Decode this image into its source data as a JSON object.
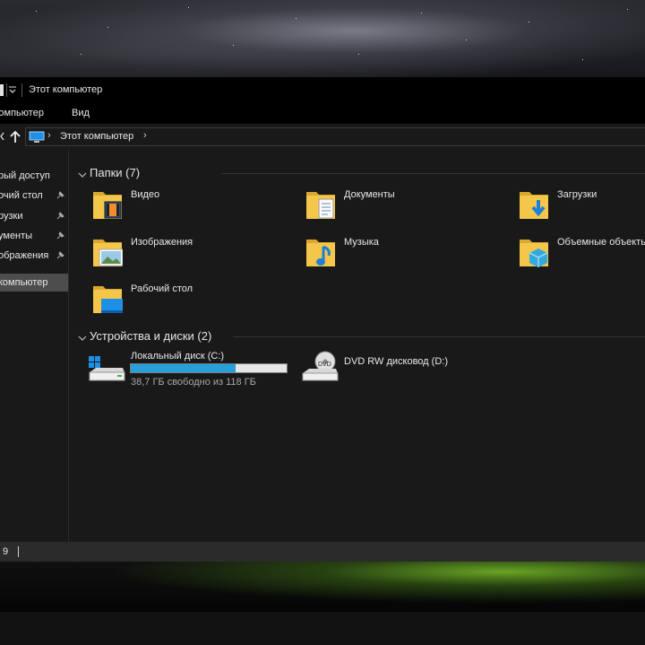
{
  "window": {
    "title": "Этот компьютер",
    "ribbon_tabs": [
      "Компьютер",
      "Вид"
    ],
    "address": {
      "path": "Этот компьютер"
    },
    "status": "9"
  },
  "nav": {
    "items": [
      {
        "label": "рый доступ",
        "pinned": false,
        "selected": false
      },
      {
        "label": "очий стол",
        "pinned": true,
        "selected": false
      },
      {
        "label": "рузки",
        "pinned": true,
        "selected": false
      },
      {
        "label": "ументы",
        "pinned": true,
        "selected": false
      },
      {
        "label": "ображения",
        "pinned": true,
        "selected": false
      },
      {
        "label": "компьютер",
        "pinned": false,
        "selected": true
      }
    ]
  },
  "content": {
    "folders_header": "Папки (7)",
    "folders": [
      {
        "label": "Видео",
        "icon": "video-folder-icon"
      },
      {
        "label": "Документы",
        "icon": "documents-folder-icon"
      },
      {
        "label": "Загрузки",
        "icon": "downloads-folder-icon"
      },
      {
        "label": "Изображения",
        "icon": "pictures-folder-icon"
      },
      {
        "label": "Музыка",
        "icon": "music-folder-icon"
      },
      {
        "label": "Объемные объекты",
        "icon": "3d-objects-folder-icon"
      },
      {
        "label": "Рабочий стол",
        "icon": "desktop-folder-icon"
      }
    ],
    "devices_header": "Устройства и диски (2)",
    "devices": [
      {
        "label": "Локальный диск (C:)",
        "free_text": "38,7 ГБ свободно из 118 ГБ",
        "used_fraction": 0.67,
        "icon": "windows-drive-icon"
      },
      {
        "label": "DVD RW дисковод (D:)",
        "icon": "dvd-drive-icon",
        "icon_text": "DVD"
      }
    ]
  },
  "colors": {
    "bar_fill": "#26a0da",
    "folder_yellow": "#f4c74b",
    "accent_blue": "#1e90e8"
  }
}
